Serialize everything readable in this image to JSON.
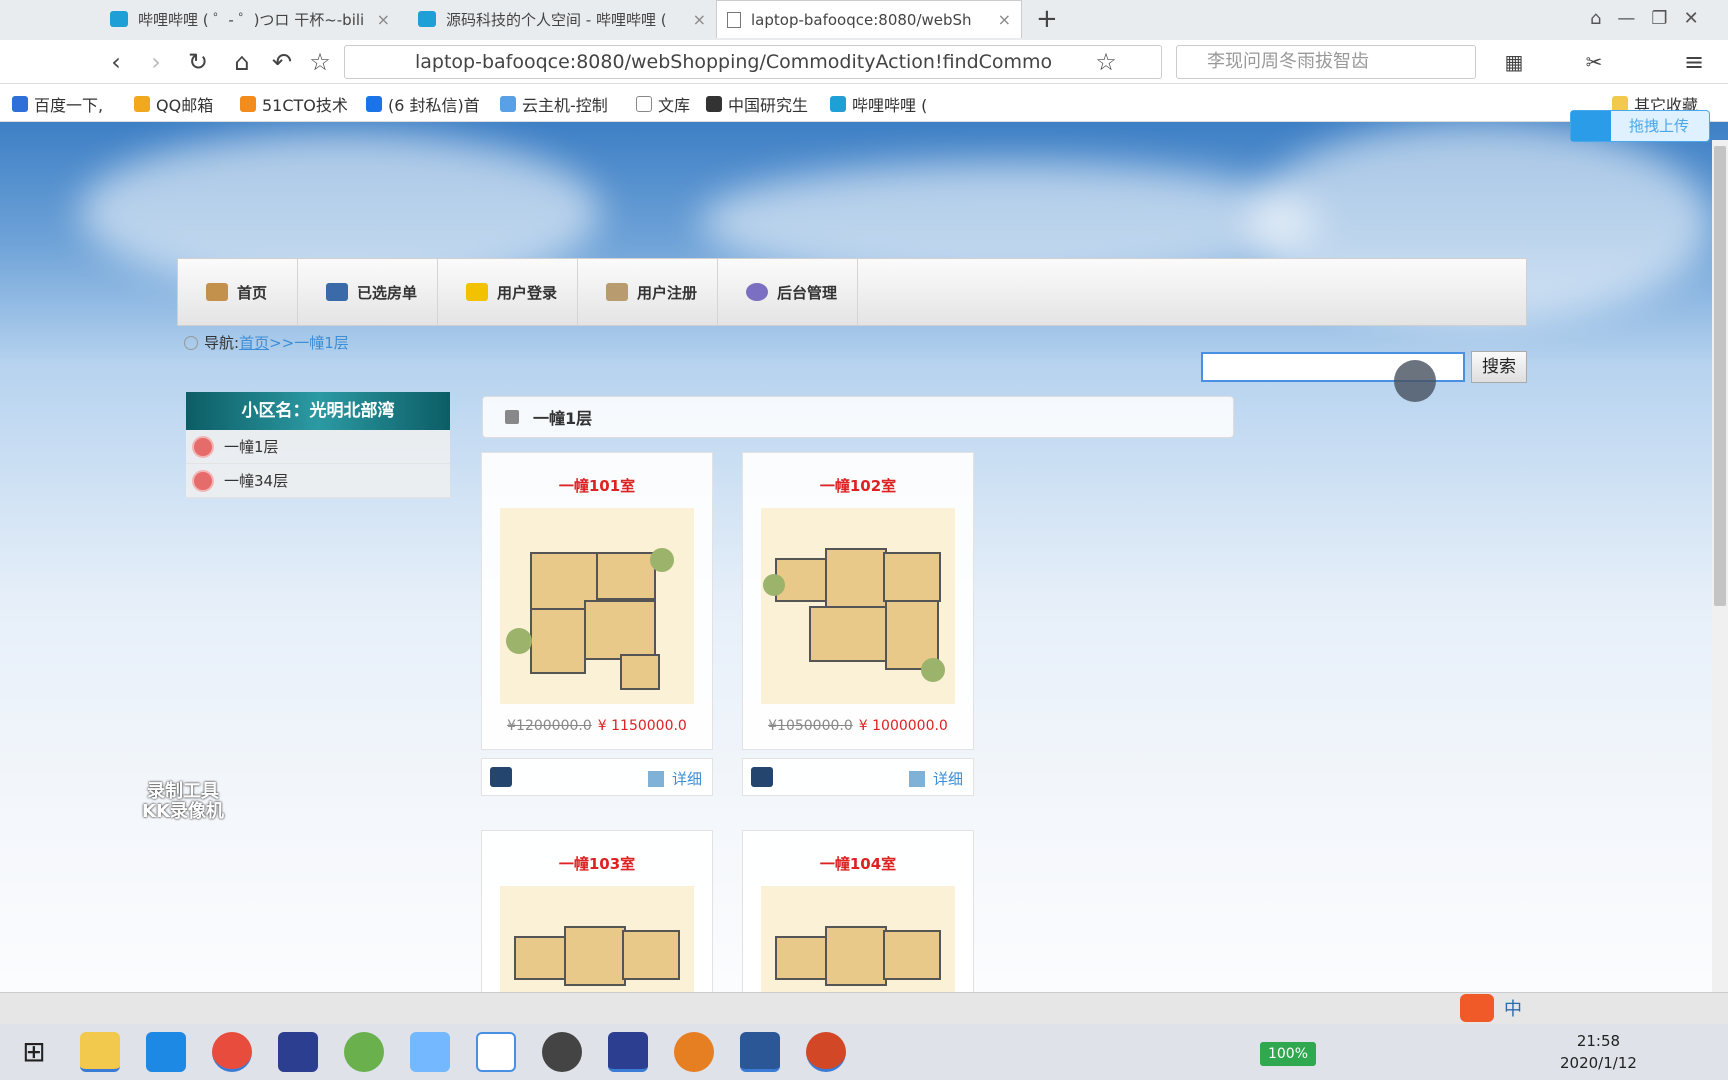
{
  "browser": {
    "tabs": [
      {
        "title": "哔哩哔哩 ( ゜- ゜)つロ 干杯~-bili",
        "active": false
      },
      {
        "title": "源码科技的个人空间 - 哔哩哔哩 (",
        "active": false
      },
      {
        "title": "laptop-bafooqce:8080/webSh",
        "active": true
      }
    ],
    "new_tab": "+",
    "close": "×",
    "url": "laptop-bafooqce:8080/webShopping/CommodityAction!findCommo",
    "search_placeholder": "李现问周冬雨拔智齿",
    "bookmarks": [
      "百度一下,",
      "QQ邮箱",
      "51CTO技术",
      "(6 封私信)首",
      "云主机-控制",
      "文库",
      "中国研究生",
      "哔哩哔哩 (",
      "其它收藏"
    ],
    "upload_label": "拖拽上传"
  },
  "site": {
    "nav": [
      "首页",
      "已选房单",
      "用户登录",
      "用户注册",
      "后台管理"
    ],
    "crumb_label": "导航:",
    "crumb_home": "首页",
    "crumb_current": ">>一幢1层",
    "search_button": "搜索",
    "sidebar_title": "小区名：光明北部湾",
    "sidebar_items": [
      "一幢1层",
      "一幢34层"
    ],
    "section_title": "一幢1层",
    "detail_label": "详细",
    "products": [
      {
        "name": "一幢101室",
        "old_price": "¥1200000.0",
        "price": "¥ 1150000.0"
      },
      {
        "name": "一幢102室",
        "old_price": "¥1050000.0",
        "price": "¥ 1000000.0"
      },
      {
        "name": "一幢103室"
      },
      {
        "name": "一幢104室"
      }
    ]
  },
  "overlay": {
    "watermark_line1": "录制工具",
    "watermark_line2": "KK录像机"
  },
  "system": {
    "battery": "100%",
    "time": "21:58",
    "date": "2020/1/12",
    "ime": "中"
  }
}
